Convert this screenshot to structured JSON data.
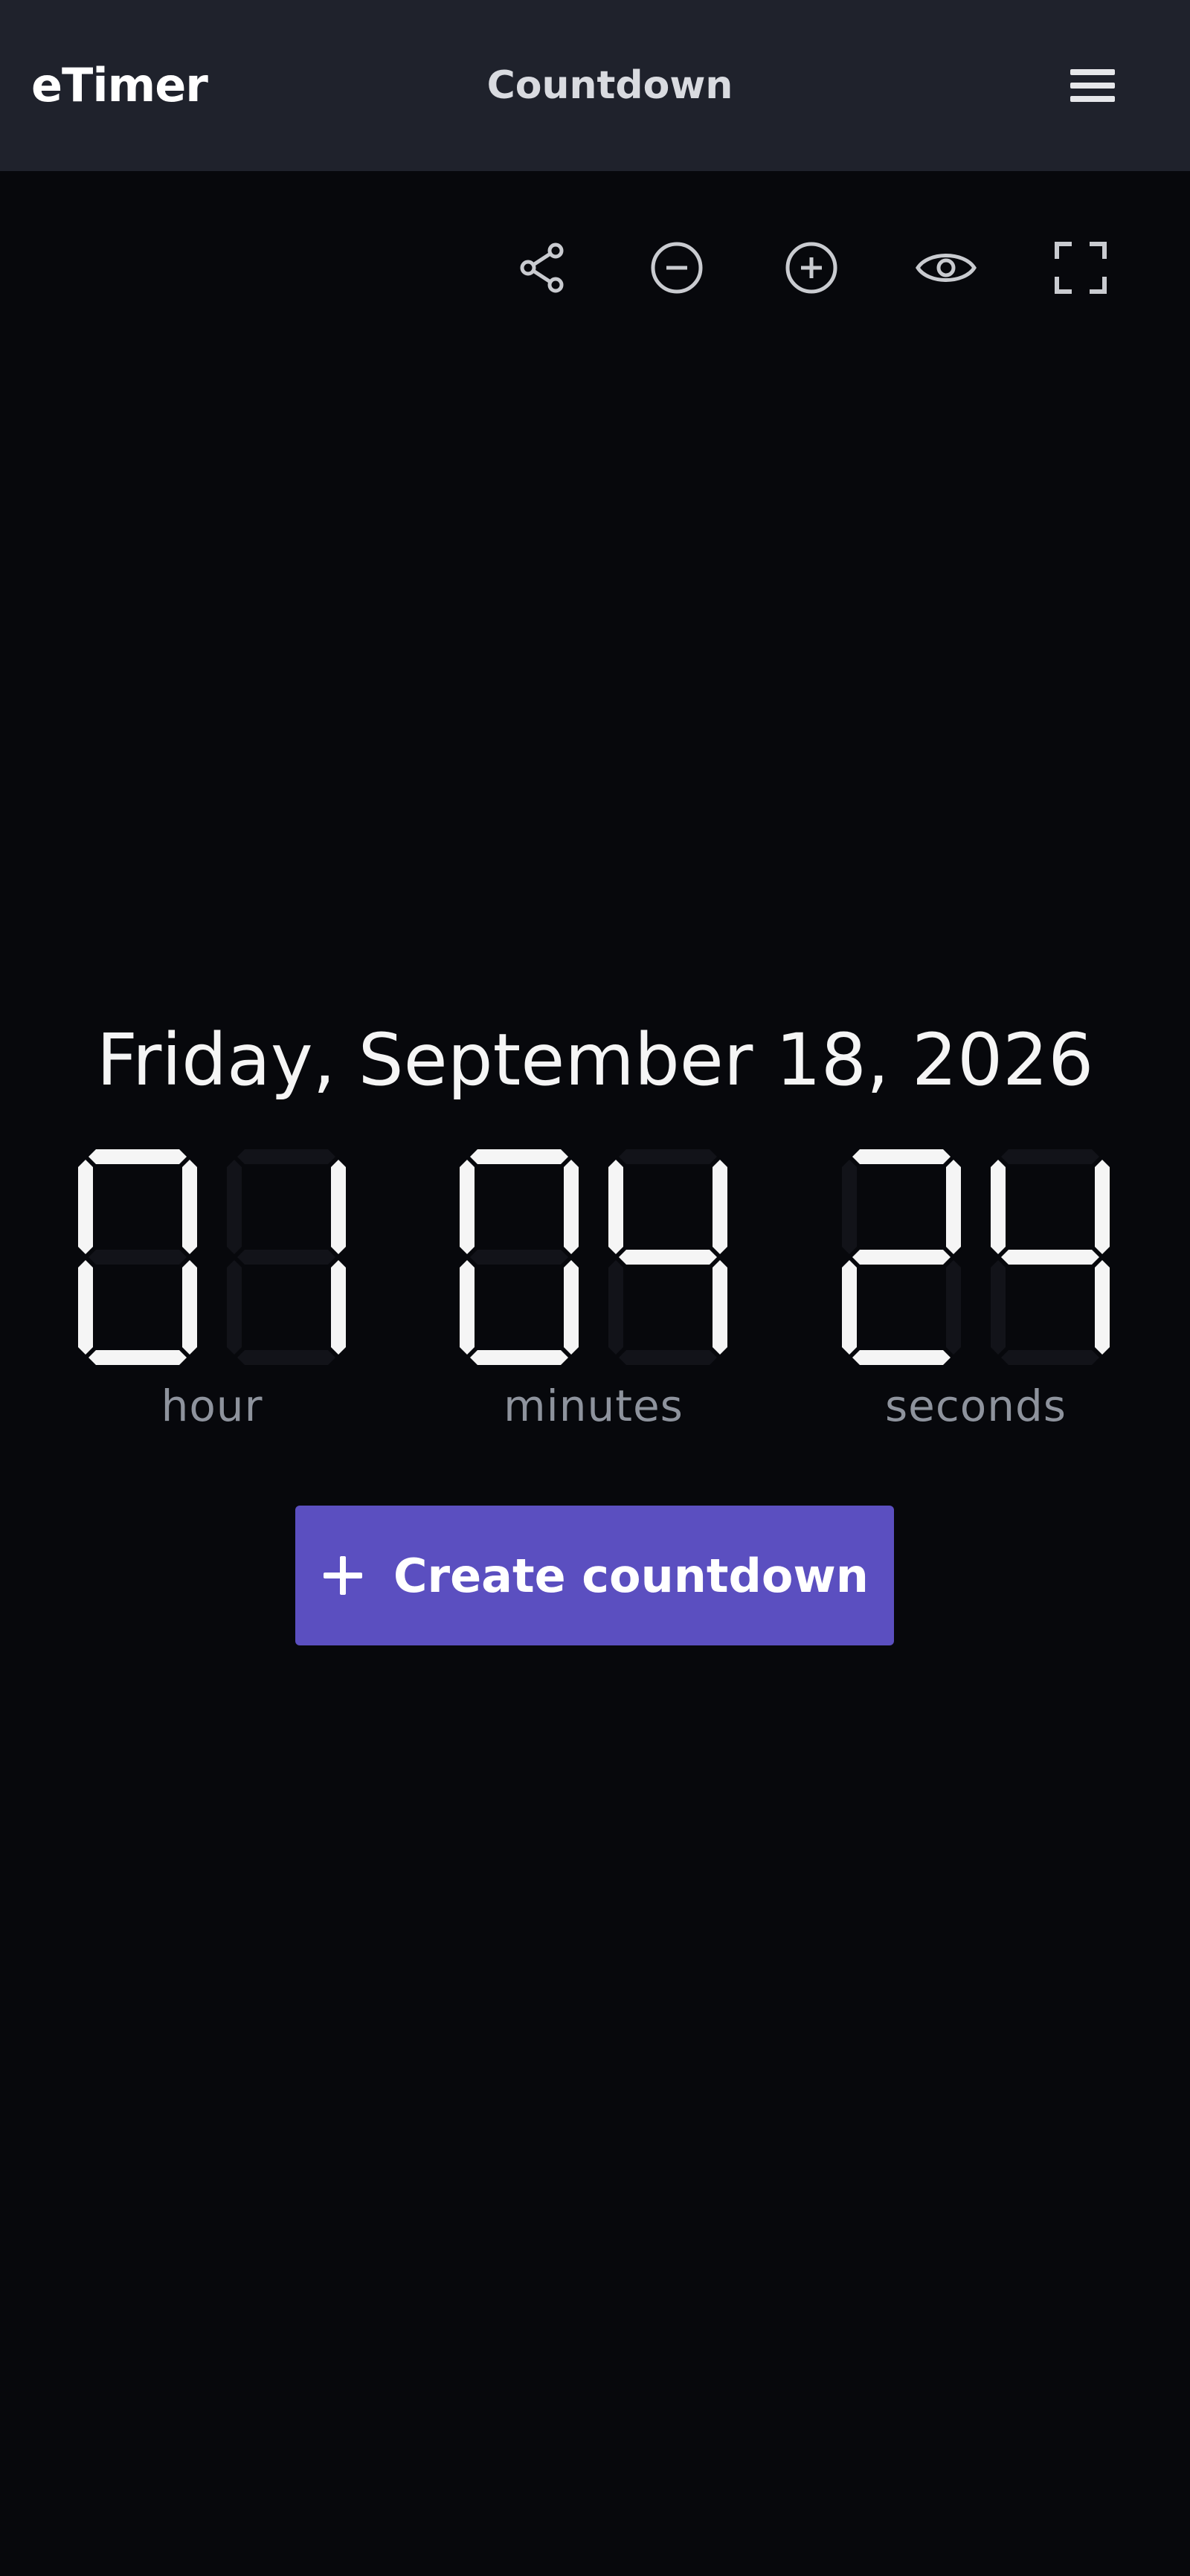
{
  "header": {
    "logo": "eTimer",
    "title": "Countdown",
    "menu_icon": "hamburger-menu-icon"
  },
  "toolbar": {
    "buttons": [
      {
        "name": "share",
        "icon": "share-icon"
      },
      {
        "name": "zoom-out",
        "icon": "minus-circle-icon"
      },
      {
        "name": "zoom-in",
        "icon": "plus-circle-icon"
      },
      {
        "name": "view",
        "icon": "eye-icon"
      },
      {
        "name": "fullscreen",
        "icon": "fullscreen-icon"
      }
    ]
  },
  "countdown": {
    "date": "Friday, September 18, 2026",
    "hours": "01",
    "minutes": "04",
    "seconds": "24",
    "labels": {
      "hours": "hour",
      "minutes": "minutes",
      "seconds": "seconds"
    }
  },
  "create_button": {
    "label": "Create countdown",
    "icon": "plus-icon"
  },
  "colors": {
    "background": "#07080c",
    "header": "#1f222c",
    "segment_on": "#f5f5f5",
    "segment_off": "#121319",
    "accent": "#5b4fc0",
    "label": "#8e939d"
  }
}
